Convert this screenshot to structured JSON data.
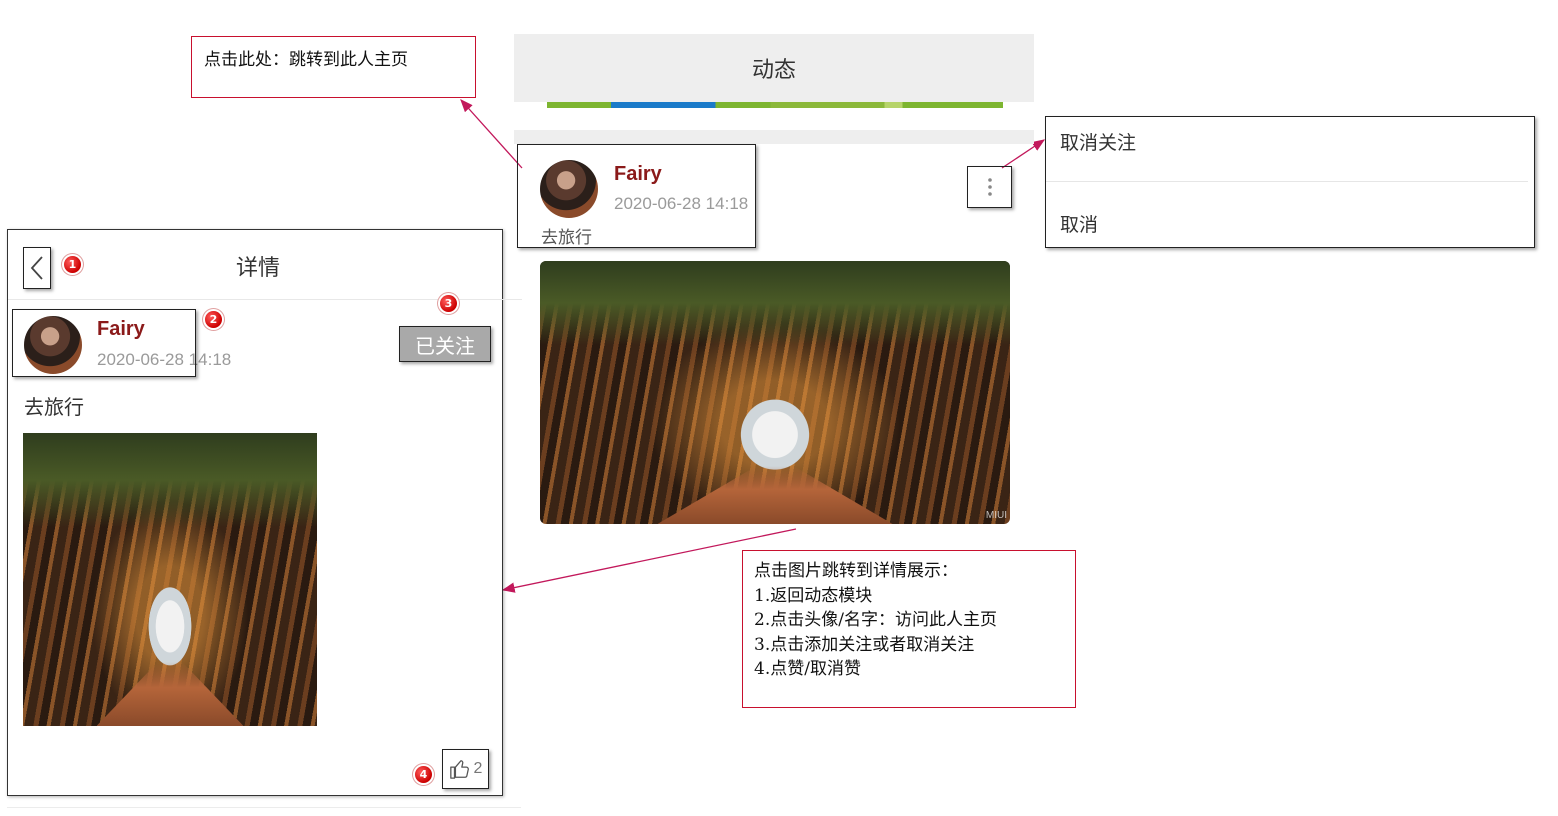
{
  "feed": {
    "header_title": "动态",
    "post": {
      "author_name": "Fairy",
      "timestamp": "2020-06-28 14:18",
      "text": "去旅行",
      "photo_watermark": "MIUI"
    }
  },
  "popup_menu": {
    "items": [
      "取消关注",
      "取消"
    ]
  },
  "detail": {
    "title": "详情",
    "author_name": "Fairy",
    "timestamp": "2020-06-28 14:18",
    "follow_button_label": "已关注",
    "text": "去旅行",
    "like_count": "2"
  },
  "badges": [
    "1",
    "2",
    "3",
    "4"
  ],
  "annotations": {
    "profile_note": "点击此处：跳转到此人主页",
    "detail_note": {
      "line1": "点击图片跳转到详情展示：",
      "line2": "1.返回动态模块",
      "line3": "2.点击头像/名字：访问此人主页",
      "line4": "3.点击添加关注或者取消关注",
      "line5": "4.点赞/取消赞"
    }
  },
  "colors": {
    "annotation_border": "#c8102e",
    "name_color": "#8b1a1a",
    "badge": "#cc0000",
    "arrow": "#c2185b"
  },
  "icons": [
    "back-arrow-icon",
    "more-vertical-icon",
    "thumbs-up-icon"
  ]
}
